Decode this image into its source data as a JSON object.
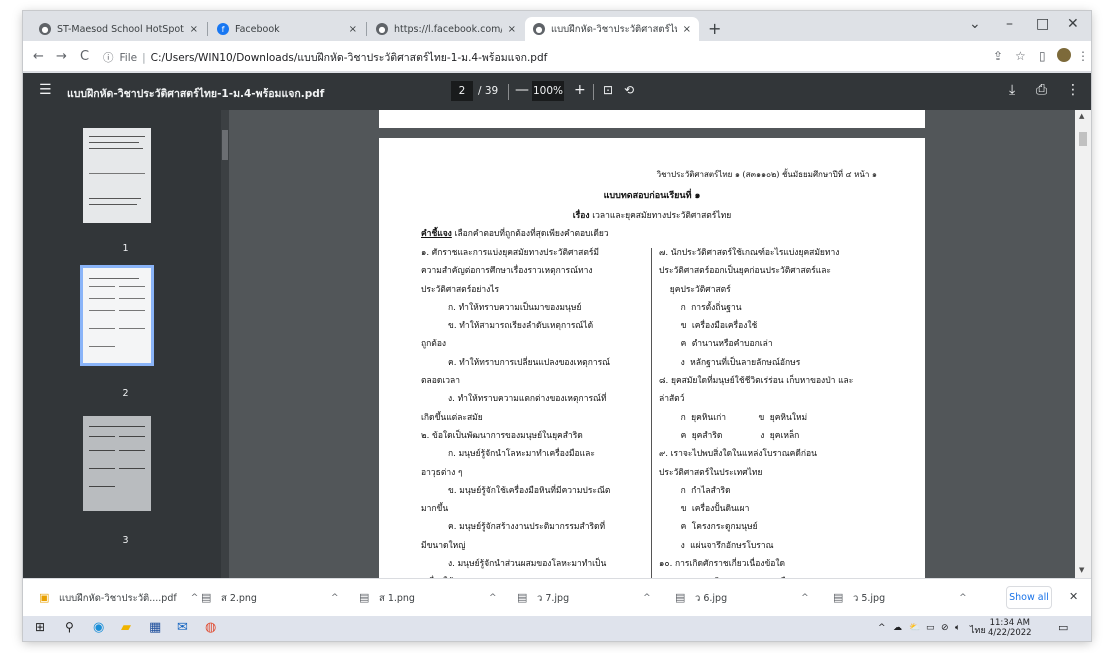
{
  "tabs": [
    {
      "title": "ST-Maesod School HotSpot W...",
      "favicon": "globe-icon",
      "x": "×"
    },
    {
      "title": "Facebook",
      "favicon": "facebook-icon",
      "x": "×"
    },
    {
      "title": "https://l.facebook.com/l.php?u=...",
      "favicon": "globe-icon",
      "x": "×"
    },
    {
      "title": "แบบฝึกหัด-วิชาประวัติศาสตร์ไทย-1-ม...",
      "favicon": "globe-icon",
      "x": "×"
    }
  ],
  "new_tab": "+",
  "window_controls": {
    "chevron": "⌄",
    "minimize": "–",
    "maximize": "□",
    "close": "✕"
  },
  "toolbar": {
    "back": "←",
    "forward": "→",
    "reload": "C",
    "info_label": "File",
    "url": "C:/Users/WIN10/Downloads/แบบฝึกหัด-วิชาประวัติศาสตร์ไทย-1-ม.4-พร้อมแจก.pdf"
  },
  "pdf": {
    "menu_icon": "☰",
    "title": "แบบฝึกหัด-วิชาประวัติศาสตร์ไทย-1-ม.4-พร้อมแจก.pdf",
    "page_current": "2",
    "page_total": "/ 39",
    "zoom_out": "—",
    "zoom": "100%",
    "zoom_in": "+",
    "download_icon": "⤓",
    "print_icon": "⎙",
    "more_icon": "⋮"
  },
  "thumbnails": [
    {
      "number": "1"
    },
    {
      "number": "2"
    },
    {
      "number": "3"
    }
  ],
  "page": {
    "header": "วิชาประวัติศาสตร์ไทย ๑ (ส๓๑๑๐๒) ชั้นมัธยมศึกษาปีที่ ๔ หน้า ๑",
    "title": "แบบทดสอบก่อนเรียนที่ ๑",
    "subject_label": "เรื่อง",
    "subject": "เวลาและยุคสมัยทางประวัติศาสตร์ไทย",
    "directions_label": "คำชี้แจง",
    "directions": "เลือกคำตอบที่ถูกต้องที่สุดเพียงคำตอบเดียว",
    "left_lines": [
      "๑. ศักราชและการแบ่งยุคสมัยทางประวัติศาสตร์มี",
      "ความสำคัญต่อการศึกษาเรื่องราวเหตุการณ์ทาง",
      "ประวัติศาสตร์อย่างไร",
      "          ก. ทำให้ทราบความเป็นมาของมนุษย์",
      "          ข. ทำให้สามารถเรียงลำดับเหตุการณ์ได้",
      "ถูกต้อง",
      "          ค. ทำให้ทราบการเปลี่ยนแปลงของเหตุการณ์",
      "ตลอดเวลา",
      "          ง. ทำให้ทราบความแตกต่างของเหตุการณ์ที่",
      "เกิดขึ้นแต่ละสมัย",
      "๒. ข้อใดเป็นพัฒนาการของมนุษย์ในยุคสำริด",
      "          ก. มนุษย์รู้จักนำโลหะมาทำเครื่องมือและ",
      "อาวุธต่าง ๆ",
      "          ข. มนุษย์รู้จักใช้เครื่องมือหินที่มีความประณีต",
      "มากขึ้น",
      "          ค. มนุษย์รู้จักสร้างงานประติมากรรมสำริดที่",
      "มีขนาดใหญ่",
      "          ง. มนุษย์รู้จักนำส่วนผสมของโลหะมาทำเป็น",
      "เครื่องใช้และอาวุธ"
    ],
    "right_lines": [
      "๗. นักประวัติศาสตร์ใช้เกณฑ์อะไรแบ่งยุคสมัยทาง",
      "ประวัติศาสตร์ออกเป็นยุคก่อนประวัติศาสตร์และ",
      "    ยุคประวัติศาสตร์",
      "        ก  การตั้งถิ่นฐาน",
      "        ข  เครื่องมือเครื่องใช้",
      "        ค  ตำนานหรือคำบอกเล่า",
      "        ง  หลักฐานที่เป็นลายลักษณ์อักษร",
      "๘. ยุคสมัยใดที่มนุษย์ใช้ชีวิตเร่ร่อน เก็บหาของป่า และ",
      "ล่าสัตว์",
      "        ก  ยุคหินเก่า            ข  ยุคหินใหม่",
      "        ค  ยุคสำริด              ง  ยุคเหล็ก",
      "๙. เราจะไปพบสิ่งใดในแหล่งโบราณคดีก่อน",
      "ประวัติศาสตร์ในประเทศไทย",
      "        ก  กำไลสำริด",
      "        ข  เครื่องปั้นดินเผา",
      "        ค  โครงกระดูกมนุษย์",
      "        ง  แผ่นจารึกอักษรโบราณ",
      "๑๐. การเกิดศักราชเกี่ยวเนื่องข้อใด",
      "        ก. เศรษฐกิจ          ข. การเมือง"
    ]
  },
  "downloads": [
    {
      "name": "แบบฝึกหัด-วิชาประวัติ....pdf",
      "icon": "pdf-file-icon",
      "chevron": "^"
    },
    {
      "name": "ส 2.png",
      "icon": "image-file-icon",
      "chevron": "^"
    },
    {
      "name": "ส 1.png",
      "icon": "image-file-icon",
      "chevron": "^"
    },
    {
      "name": "ว 7.jpg",
      "icon": "image-file-icon",
      "chevron": "^"
    },
    {
      "name": "ว 6.jpg",
      "icon": "image-file-icon",
      "chevron": "^"
    },
    {
      "name": "ว 5.jpg",
      "icon": "image-file-icon",
      "chevron": "^"
    }
  ],
  "show_all": "Show all",
  "downloads_close": "✕",
  "taskbar": {
    "language": "ไทย",
    "time": "11:34 AM",
    "date": "4/22/2022",
    "tray_up": "^"
  },
  "colors": {
    "chrome_tab": "#dee1e6",
    "pdf_bar": "#323639",
    "viewer_bg": "#525659",
    "accent": "#1a73e8",
    "thumb_select": "#8ab4f8"
  }
}
